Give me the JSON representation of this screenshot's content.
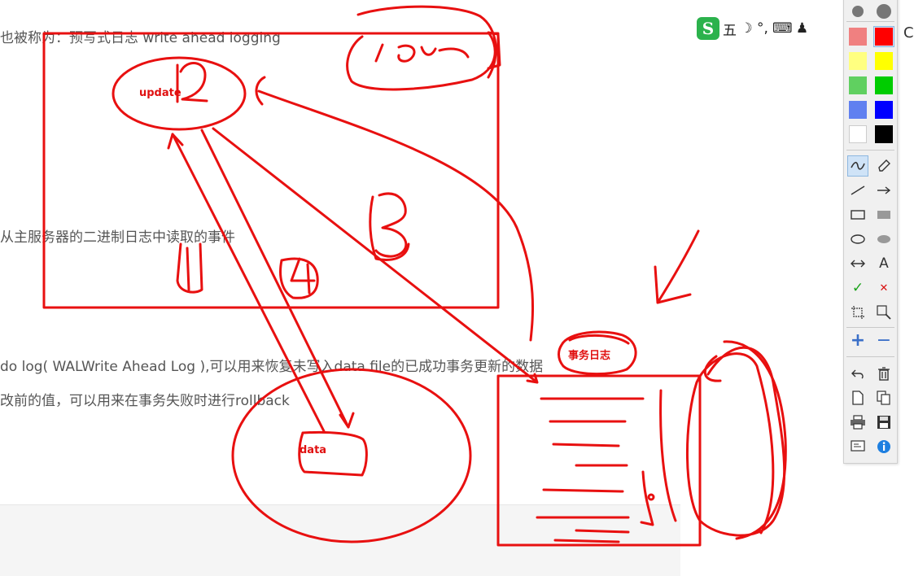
{
  "document": {
    "lines": [
      "也被称为：预写式日志 write ahead logging",
      "从主服务器的二进制日志中读取的事件",
      "do log( WALWrite Ahead Log ),可以用来恢复未写入data file的已成功事务更新的数据",
      "改前的值，可以用来在事务失败时进行rollback"
    ]
  },
  "annotations": {
    "box_label": "Dms",
    "update_label": "update",
    "data_label": "data",
    "log_label": "事务日志",
    "step_numbers": [
      "1",
      "2",
      "3",
      "4"
    ]
  },
  "ime_bar": {
    "logo": "S",
    "mode": "五",
    "moon": "☽",
    "punct": "°,",
    "keyboard": "⌨",
    "user": "♟",
    "right_glyph": "C"
  },
  "palette": {
    "colors": [
      [
        "#f08080",
        "#ff0000"
      ],
      [
        "#ffff80",
        "#ffff00"
      ],
      [
        "#60d060",
        "#00cc00"
      ],
      [
        "#6080f0",
        "#0000ff"
      ],
      [
        "#ffffff",
        "#000000"
      ]
    ],
    "selected_color": "#ff0000",
    "text_tool": "A",
    "check": "✓",
    "cross": "✕",
    "plus": "+",
    "minus": "−"
  }
}
